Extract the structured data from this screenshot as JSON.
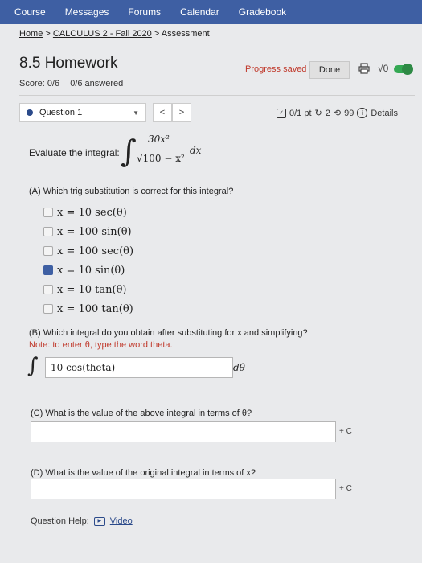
{
  "nav": {
    "items": [
      "Course",
      "Messages",
      "Forums",
      "Calendar",
      "Gradebook"
    ]
  },
  "breadcrumb": {
    "home": "Home",
    "sep1": ">",
    "course": "CALCULUS 2 - Fall 2020",
    "sep2": ">",
    "current": "Assessment"
  },
  "header": {
    "title": "8.5 Homework",
    "score": "Score: 0/6",
    "answered": "0/6 answered",
    "progress": "Progress saved",
    "done": "Done",
    "sqrt_label": "√0"
  },
  "question_bar": {
    "selected": "Question 1",
    "prev": "<",
    "next": ">",
    "points": "0/1 pt",
    "retries": "2",
    "attempts": "99",
    "details": "Details"
  },
  "question": {
    "evaluate": "Evaluate the integral:",
    "numerator": "30x²",
    "denominator": "√100 − x²",
    "dx": "dx",
    "partA_prompt": "(A) Which trig substitution is correct for this integral?",
    "options": [
      "x = 10 sec(θ)",
      "x = 100 sin(θ)",
      "x = 100 sec(θ)",
      "x = 10 sin(θ)",
      "x = 10 tan(θ)",
      "x = 100 tan(θ)"
    ],
    "selected_option": 3,
    "partB_prompt": "(B) Which integral do you obtain after substituting for x and simplifying?",
    "partB_note": "Note: to enter θ, type the word theta.",
    "partB_value": "10 cos(theta)",
    "dtheta": "dθ",
    "partC_prompt": "(C) What is the value of the above integral in terms of θ?",
    "partC_value": "",
    "plus_c": "+ C",
    "partD_prompt": "(D) What is the value of the original integral in terms of x?",
    "partD_value": "",
    "help_label": "Question Help:",
    "video_label": "Video"
  },
  "colors": {
    "nav_bg": "#3e5fa3",
    "accent_red": "#c0392b",
    "toggle_green": "#34a853"
  }
}
